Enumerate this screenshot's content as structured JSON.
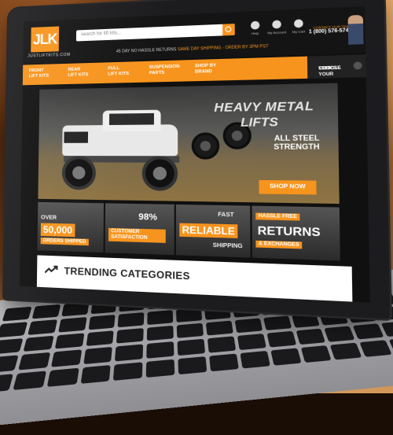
{
  "site": {
    "logo_text": "JLK",
    "logo_subtext": "JUSTLIFTKITS.COM",
    "search_placeholder": "search for lift kits...",
    "promo_text": "45 DAY NO HASSLE RETURNS",
    "promo_highlight": "SAME DAY SHIPPING - ORDER BY 3PM PST",
    "header_icons": [
      {
        "icon": "help-icon",
        "label": "Help"
      },
      {
        "icon": "account-icon",
        "label": "My Account"
      },
      {
        "icon": "cart-icon",
        "label": "My Cart"
      }
    ],
    "contact_label": "CONTACT OUR TEAM",
    "contact_phone": "1 (800) 576-5748",
    "nav": [
      {
        "line1": "FRONT",
        "line2": "LIFT KITS"
      },
      {
        "line1": "REAR",
        "line2": "LIFT KITS"
      },
      {
        "line1": "FULL",
        "line2": "LIFT KITS"
      },
      {
        "line1": "SUSPENSION",
        "line2": "PARTS"
      },
      {
        "line1": "SHOP BY",
        "line2": "BRAND"
      }
    ],
    "vehicle_selector": {
      "line1": "CHOOSE YOUR",
      "line2": "VEHICLE"
    },
    "hero": {
      "title_line1": "HEAVY METAL",
      "title_line2": "LIFTS",
      "subtitle_line1": "ALL STEEL",
      "subtitle_line2": "STRENGTH",
      "cta": "SHOP NOW"
    },
    "tiles": [
      {
        "prefix": "OVER",
        "big": "50,000",
        "sub": "ORDERS SHIPPED"
      },
      {
        "prefix": "",
        "big": "98%",
        "sub": "CUSTOMER SATISFACTION"
      },
      {
        "prefix": "FAST",
        "big": "RELIABLE",
        "sub": "SHIPPING"
      },
      {
        "prefix": "HASSLE FREE",
        "big": "RETURNS",
        "sub": "& EXCHANGES"
      }
    ],
    "trending_title": "TRENDING CATEGORIES"
  },
  "colors": {
    "brand_orange": "#f7941d",
    "header_dark": "#141414",
    "panel_white": "#ffffff"
  }
}
